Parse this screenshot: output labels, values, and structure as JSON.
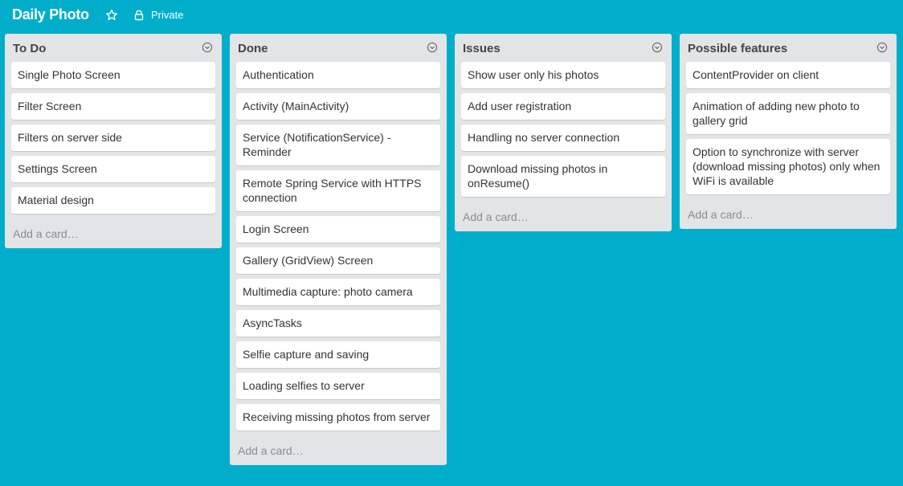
{
  "board": {
    "title": "Daily Photo",
    "privacy_label": "Private",
    "star_icon": "star-icon",
    "lock_icon": "lock-icon"
  },
  "colors": {
    "background": "#00AECC",
    "list_bg": "#E2E4E6",
    "card_bg": "#FFFFFF",
    "text": "#333333",
    "muted": "#8C8C8C"
  },
  "lists": [
    {
      "title": "To Do",
      "cards": [
        "Single Photo Screen",
        "Filter Screen",
        "Filters on server side",
        "Settings Screen",
        "Material design"
      ],
      "add_card": "Add a card…"
    },
    {
      "title": "Done",
      "cards": [
        "Authentication",
        "Activity (MainActivity)",
        "Service (NotificationService) - Reminder",
        "Remote Spring Service with HTTPS connection",
        "Login Screen",
        "Gallery (GridView) Screen",
        "Multimedia capture: photo camera",
        "AsyncTasks",
        "Selfie capture and saving",
        "Loading selfies to server",
        "Receiving missing photos from server"
      ],
      "add_card": "Add a card…"
    },
    {
      "title": "Issues",
      "cards": [
        "Show user only his photos",
        "Add user registration",
        "Handling no server connection",
        "Download missing photos in onResume()"
      ],
      "add_card": "Add a card…"
    },
    {
      "title": "Possible features",
      "cards": [
        "ContentProvider on client",
        "Animation of adding new photo to gallery grid",
        "Option to synchronize with server (download missing photos) only when WiFi is available"
      ],
      "add_card": "Add a card…"
    }
  ]
}
